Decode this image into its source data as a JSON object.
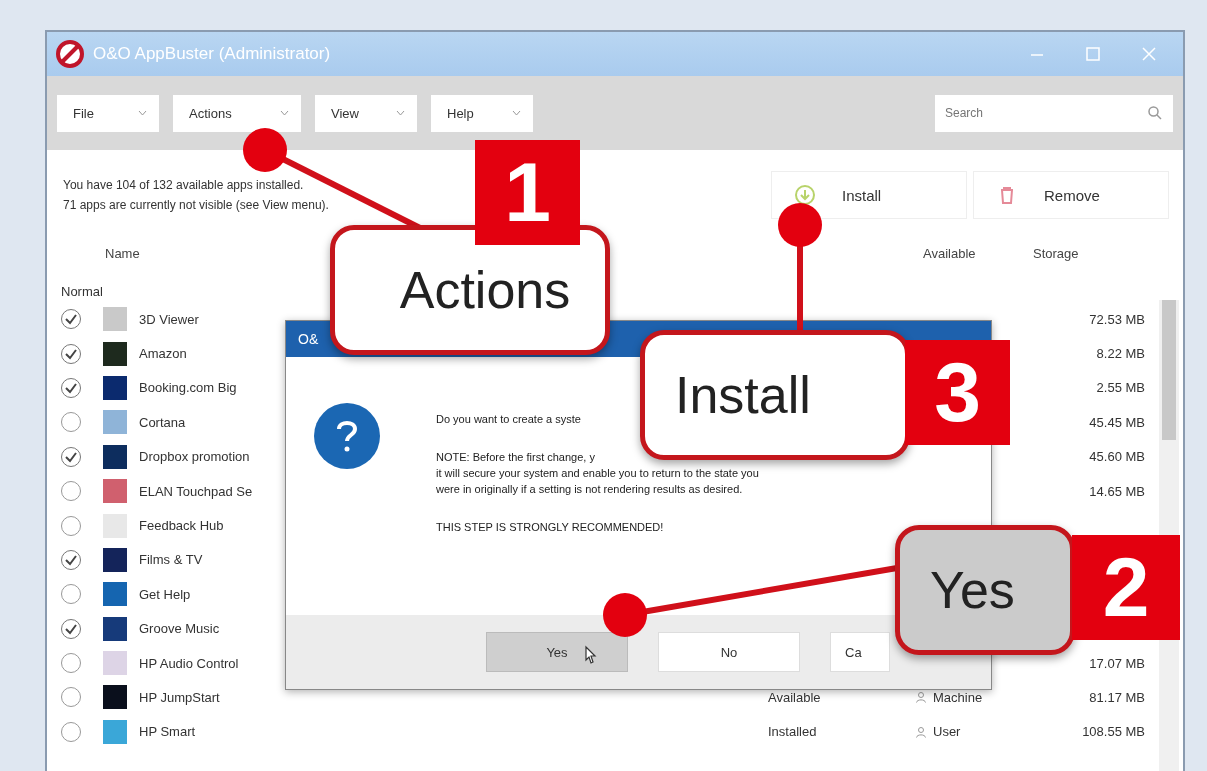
{
  "window": {
    "title": "O&O AppBuster (Administrator)"
  },
  "menu": [
    {
      "label": "File"
    },
    {
      "label": "Actions"
    },
    {
      "label": "View"
    },
    {
      "label": "Help"
    }
  ],
  "search": {
    "placeholder": "Search"
  },
  "info": [
    "You have 104 of 132 available apps installed.",
    "71 apps are currently not visible (see View menu)."
  ],
  "actions": [
    {
      "label": "Install",
      "kind": "install"
    },
    {
      "label": "Remove",
      "kind": "remove"
    }
  ],
  "columns": [
    "Name",
    "Available",
    "Storage"
  ],
  "group": "Normal",
  "apps": [
    {
      "name": "3D Viewer",
      "checked": true,
      "color": "#c9c9c9",
      "size": "72.53 MB"
    },
    {
      "name": "Amazon",
      "checked": true,
      "color": "#1e2a1e",
      "size": "8.22 MB"
    },
    {
      "name": "Booking.com Big",
      "checked": true,
      "color": "#0b2a6e",
      "size": "2.55 MB"
    },
    {
      "name": "Cortana",
      "checked": false,
      "color": "#8fb4d8",
      "size": "45.45 MB"
    },
    {
      "name": "Dropbox promotion",
      "checked": true,
      "color": "#0d2d5e",
      "size": "45.60 MB"
    },
    {
      "name": "ELAN Touchpad Se",
      "checked": false,
      "color": "#d0606e",
      "size": "14.65 MB"
    },
    {
      "name": "Feedback Hub",
      "checked": false,
      "color": "#e8e8e8"
    },
    {
      "name": "Films & TV",
      "checked": true,
      "color": "#14245a"
    },
    {
      "name": "Get Help",
      "checked": false,
      "color": "#1565b0"
    },
    {
      "name": "Groove Music",
      "checked": true,
      "color": "#163a7a"
    },
    {
      "name": "HP Audio Control",
      "checked": false,
      "color": "#ddd4e6",
      "size": "17.07 MB"
    },
    {
      "name": "HP JumpStart",
      "checked": false,
      "color": "#0a0f1c",
      "state": "Available",
      "scope": "Machine",
      "size": "81.17 MB"
    },
    {
      "name": "HP Smart",
      "checked": false,
      "color": "#3aa7d8",
      "state": "Installed",
      "scope": "User",
      "size": "108.55 MB"
    }
  ],
  "dialog": {
    "title": "O&",
    "lines": [
      "Do you want to create a syste",
      "NOTE: Before the first change, y",
      "it will secure your system and enable you to return to the state you",
      "were in originally if a setting is not rendering results as desired.",
      "THIS STEP IS STRONGLY RECOMMENDED!"
    ],
    "buttons": [
      {
        "label": "Yes",
        "selected": true
      },
      {
        "label": "No",
        "selected": false
      },
      {
        "label": "Ca",
        "selected": false
      }
    ]
  },
  "callouts": [
    {
      "number": "1",
      "label": "Actions",
      "highlighted": false
    },
    {
      "number": "3",
      "label": "Install",
      "highlighted": false
    },
    {
      "number": "2",
      "label": "Yes",
      "highlighted": true
    }
  ]
}
